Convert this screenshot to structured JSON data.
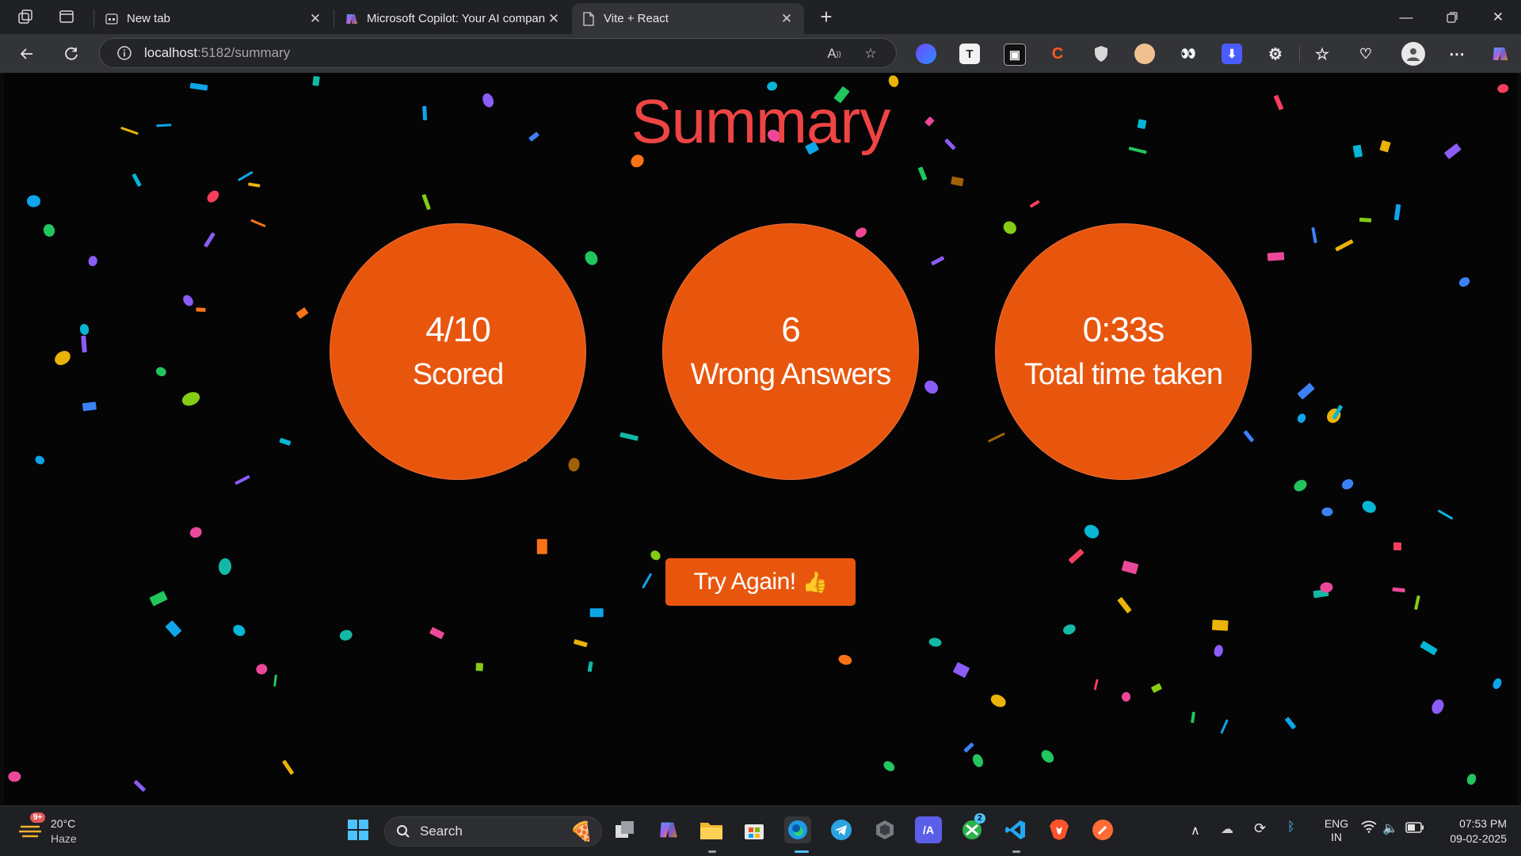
{
  "browser": {
    "tabs": [
      {
        "title": "New tab",
        "icon": "new-tab-page-icon",
        "active": false
      },
      {
        "title": "Microsoft Copilot: Your AI compan",
        "icon": "copilot-logo-icon",
        "active": false
      },
      {
        "title": "Vite + React",
        "icon": "page-icon",
        "active": true
      }
    ],
    "address": {
      "host": "localhost",
      "path": ":5182/summary"
    },
    "extension_icons": [
      "proton-vpn-icon",
      "t-extension-icon",
      "tab-extension-icon",
      "c-extension-icon",
      "shield-icon",
      "avatar-extension-icon",
      "eyes-extension-icon",
      "download-extension-icon",
      "puzzle-extensions-icon",
      "favorites-icon",
      "health-icon",
      "profile-icon",
      "more-icon",
      "copilot-icon"
    ]
  },
  "summary": {
    "title": "Summary",
    "stats": [
      {
        "value": "4/10",
        "label": "Scored"
      },
      {
        "value": "6",
        "label": "Wrong Answers"
      },
      {
        "value": "0:33s",
        "label": "Total time taken"
      }
    ],
    "try_again_label": "Try Again",
    "try_again_icon": "thumbs-up-icon",
    "accent_color": "#e8560e",
    "title_color": "#ef4444",
    "background_color": "#050506"
  },
  "taskbar": {
    "weather": {
      "temp": "20°C",
      "condition": "Haze",
      "badge": "9+"
    },
    "search_label": "Search",
    "apps": [
      "start-icon",
      "task-view-icon",
      "copilot-app-icon",
      "file-explorer-icon",
      "store-icon",
      "edge-icon",
      "telegram-icon",
      "github-desktop-icon",
      "visual-studio-icon",
      "xbox-icon",
      "vscode-icon",
      "brave-icon",
      "postman-icon"
    ],
    "xbox_badge": "2",
    "lang_primary": "ENG",
    "lang_secondary": "IN",
    "time": "07:53 PM",
    "date": "09-02-2025"
  }
}
